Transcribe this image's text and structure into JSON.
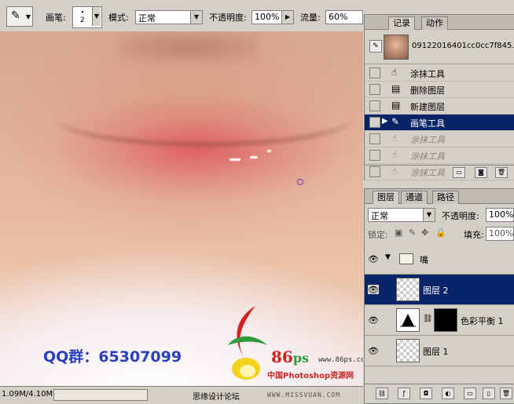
{
  "options_bar": {
    "brush_label": "画笔:",
    "brush_size": "2",
    "mode_label": "模式:",
    "mode_value": "正常",
    "opacity_label": "不透明度:",
    "opacity_value": "100%",
    "flow_label": "流量:",
    "flow_value": "60%"
  },
  "canvas": {
    "qq_text": "QQ群：65307099",
    "logo_86": "86",
    "logo_ps": "ps",
    "logo_url": "www.86ps.com",
    "logo_cn": "中国Photoshop资源网"
  },
  "status_bar": {
    "doc_size": "1.09M/4.10M",
    "forum": "思缘设计论坛",
    "site": "WWW.MISSVUAN.COM"
  },
  "history_panel": {
    "tabs": [
      "记录",
      "动作"
    ],
    "snapshot_name": "09122016401cc0cc7f845...",
    "items": [
      {
        "label": "涂抹工具",
        "state": "normal"
      },
      {
        "label": "删除图层",
        "state": "normal"
      },
      {
        "label": "新建图层",
        "state": "normal"
      },
      {
        "label": "画笔工具",
        "state": "active"
      },
      {
        "label": "涂抹工具",
        "state": "dim"
      },
      {
        "label": "涂抹工具",
        "state": "dim"
      },
      {
        "label": "涂抹工具",
        "state": "dim"
      }
    ]
  },
  "layers_panel": {
    "tabs": [
      "图层",
      "通道",
      "路径"
    ],
    "blend_mode": "正常",
    "opacity_label": "不透明度:",
    "opacity_value": "100%",
    "lock_label": "锁定:",
    "fill_label": "填充:",
    "fill_value": "100%",
    "layers": [
      {
        "name": "嘴",
        "kind": "group"
      },
      {
        "name": "图层 2",
        "kind": "pixel",
        "active": true
      },
      {
        "name": "色彩平衡 1",
        "kind": "adjustment"
      },
      {
        "name": "图层 1",
        "kind": "pixel"
      }
    ]
  },
  "colors": {
    "selection": "#0a246a",
    "panel_bg": "#d4d0c8",
    "qq_text": "#2a3fbf",
    "logo_red": "#d42020"
  }
}
